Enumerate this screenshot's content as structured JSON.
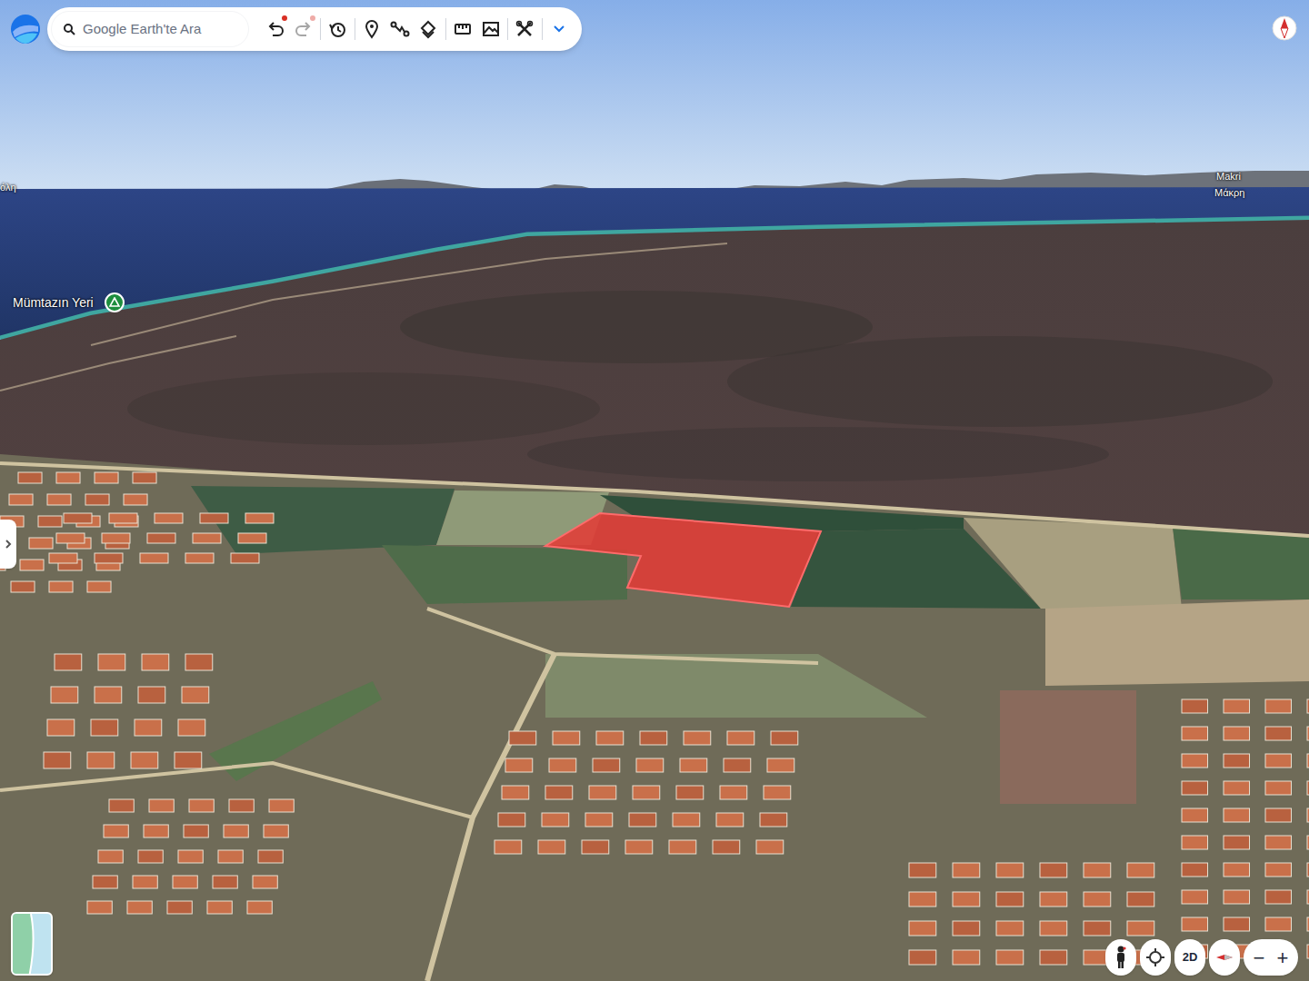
{
  "search": {
    "placeholder": "Google Earth'te Ara"
  },
  "toolbar": [
    {
      "kind": "undo",
      "dot": true,
      "disabled": false
    },
    {
      "kind": "redo",
      "dot": true,
      "disabled": true
    },
    {
      "kind": "history",
      "dot": false,
      "disabled": false
    },
    {
      "kind": "pin",
      "dot": false,
      "disabled": false
    },
    {
      "kind": "path",
      "dot": false,
      "disabled": false
    },
    {
      "kind": "layers",
      "dot": false,
      "disabled": false
    },
    {
      "kind": "ruler",
      "dot": false,
      "disabled": false
    },
    {
      "kind": "image",
      "dot": false,
      "disabled": false
    },
    {
      "kind": "tools",
      "dot": false,
      "disabled": false
    },
    {
      "kind": "expand",
      "dot": false,
      "disabled": false
    }
  ],
  "map_labels": [
    {
      "text": "όλη",
      "kind": "town"
    },
    {
      "text": "Mümtazın Yeri",
      "kind": "place"
    },
    {
      "text": "Makri",
      "kind": "town"
    },
    {
      "text": "Μάκρη",
      "kind": "town"
    }
  ],
  "view_controls": {
    "mode_button": "2D",
    "zoom": [
      "−",
      "+"
    ]
  }
}
